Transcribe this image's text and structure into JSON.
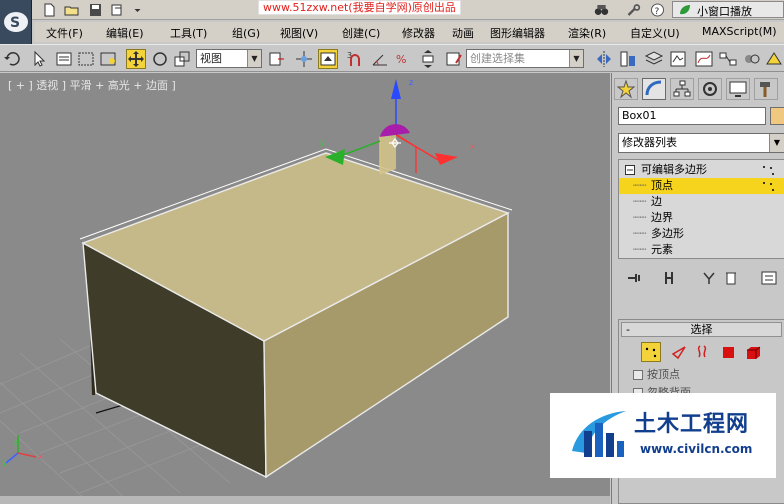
{
  "watermark_url": "www.51zxw.net(我要自学网)原创出品",
  "mini_window_label": "小窗口播放",
  "menu": [
    "文件(F)",
    "编辑(E)",
    "工具(T)",
    "组(G)",
    "视图(V)",
    "创建(C)",
    "修改器",
    "动画",
    "图形编辑器",
    "渲染(R)",
    "自定义(U)",
    "MAXScript(M)"
  ],
  "toolbar": {
    "view_combo": "视图",
    "selection_set_placeholder": "创建选择集"
  },
  "viewport": {
    "label": "[ + ] 透视 ] 平滑 + 高光 + 边面 ]",
    "gizmo_axis_x": "x",
    "gizmo_axis_y": "y",
    "gizmo_axis_z": "z",
    "corner_axis_x": "x",
    "corner_axis_y": "y",
    "corner_axis_z": "z"
  },
  "command_panel": {
    "object_name": "Box01",
    "object_color": "#f0c880",
    "modifier_list": "修改器列表",
    "stack": {
      "root": "可编辑多边形",
      "items": [
        "顶点",
        "边",
        "边界",
        "多边形",
        "元素"
      ],
      "selected_index": 0
    },
    "selection_rollout": {
      "title": "选择",
      "by_vertex": "按顶点",
      "ignore_backfacing": "忽略背面"
    }
  },
  "site_logo": {
    "name": "土木工程网",
    "url": "www.civilcn.com"
  },
  "colors": {
    "highlight": "#f6d31c",
    "box_top": "#c5b98a",
    "box_front": "#a69a6b",
    "box_left": "#3f3c2a"
  }
}
